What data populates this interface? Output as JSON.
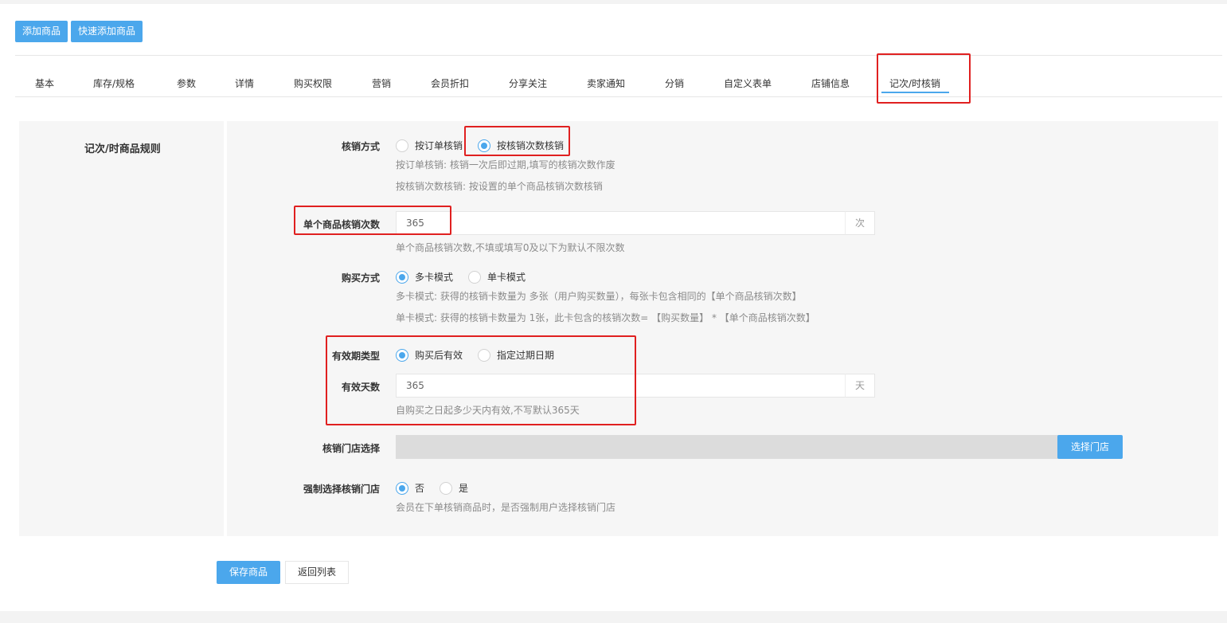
{
  "toolbar": {
    "add_product": "添加商品",
    "quick_add_product": "快速添加商品"
  },
  "tabs": [
    {
      "label": "基本"
    },
    {
      "label": "库存/规格"
    },
    {
      "label": "参数"
    },
    {
      "label": "详情"
    },
    {
      "label": "购买权限"
    },
    {
      "label": "营销"
    },
    {
      "label": "会员折扣"
    },
    {
      "label": "分享关注"
    },
    {
      "label": "卖家通知"
    },
    {
      "label": "分销"
    },
    {
      "label": "自定义表单"
    },
    {
      "label": "店铺信息"
    },
    {
      "label": "记次/时核销",
      "active": true
    }
  ],
  "section": {
    "title": "记次/时商品规则"
  },
  "form": {
    "verify_method": {
      "label": "核销方式",
      "options": [
        "按订单核销",
        "按核销次数核销"
      ],
      "selected": "按核销次数核销",
      "hint1": "按订单核销: 核销一次后即过期,填写的核销次数作废",
      "hint2": "按核销次数核销: 按设置的单个商品核销次数核销"
    },
    "verify_count": {
      "label": "单个商品核销次数",
      "value": "365",
      "suffix": "次",
      "hint": "单个商品核销次数,不填或填写0及以下为默认不限次数"
    },
    "purchase_mode": {
      "label": "购买方式",
      "options": [
        "多卡模式",
        "单卡模式"
      ],
      "selected": "多卡模式",
      "hint1": "多卡模式: 获得的核销卡数量为 多张（用户购买数量），每张卡包含相同的【单个商品核销次数】",
      "hint2": "单卡模式: 获得的核销卡数量为 1张，此卡包含的核销次数= 【购买数量】 * 【单个商品核销次数】"
    },
    "validity_type": {
      "label": "有效期类型",
      "options": [
        "购买后有效",
        "指定过期日期"
      ],
      "selected": "购买后有效"
    },
    "valid_days": {
      "label": "有效天数",
      "value": "365",
      "suffix": "天",
      "hint": "自购买之日起多少天内有效,不写默认365天"
    },
    "store_select": {
      "label": "核销门店选择",
      "button": "选择门店"
    },
    "force_store": {
      "label": "强制选择核销门店",
      "options": [
        "否",
        "是"
      ],
      "selected": "否",
      "hint": "会员在下单核销商品时，是否强制用户选择核销门店"
    }
  },
  "actions": {
    "save": "保存商品",
    "back": "返回列表"
  },
  "colors": {
    "accent": "#4ba7ec",
    "highlight_box": "#e02020",
    "panel_bg": "#f6f6f6",
    "store_field_bg": "#dcdcdc"
  }
}
